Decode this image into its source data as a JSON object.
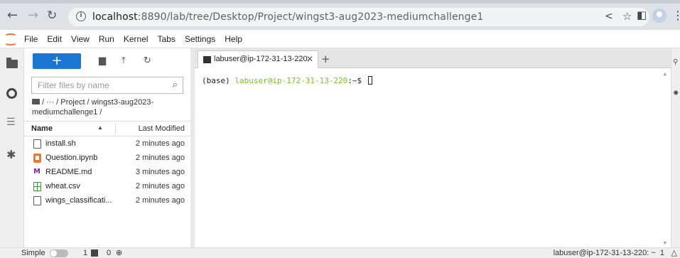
{
  "browser": {
    "url_host": "localhost",
    "url_rest": ":8890/lab/tree/Desktop/Project/wingst3-aug2023-mediumchallenge1",
    "info_icon": "i"
  },
  "menu": {
    "items": [
      "File",
      "Edit",
      "View",
      "Run",
      "Kernel",
      "Tabs",
      "Settings",
      "Help"
    ]
  },
  "filebrowser": {
    "new_label": "+",
    "search_placeholder": "Filter files by name",
    "breadcrumb": "/ ··· / Project / wingst3-aug2023-mediumchallenge1 /",
    "col_name": "Name",
    "col_modified": "Last Modified",
    "files": [
      {
        "name": "install.sh",
        "modified": "2 minutes ago",
        "icon": "file-icon"
      },
      {
        "name": "Question.ipynb",
        "modified": "2 minutes ago",
        "icon": "notebook-icon"
      },
      {
        "name": "README.md",
        "modified": "3 minutes ago",
        "icon": "markdown-icon"
      },
      {
        "name": "wheat.csv",
        "modified": "2 minutes ago",
        "icon": "csv-icon"
      },
      {
        "name": "wings_classificati...",
        "modified": "2 minutes ago",
        "icon": "file-icon"
      }
    ]
  },
  "terminal": {
    "tab_label": "labuser@ip-172-31-13-220:",
    "prompt_env": "(base) ",
    "prompt_user": "labuser@ip-172-31-13-220",
    "prompt_suffix": ":~$ "
  },
  "status": {
    "mode_label": "Simple",
    "terminal_count": "1",
    "kernel_count": "0",
    "right_text": "labuser@ip-172-31-13-220: ~",
    "right_count": "1"
  },
  "colors": {
    "accent": "#1976d2",
    "jupyter_orange": "#f37726",
    "prompt_green": "#7bc41f"
  }
}
